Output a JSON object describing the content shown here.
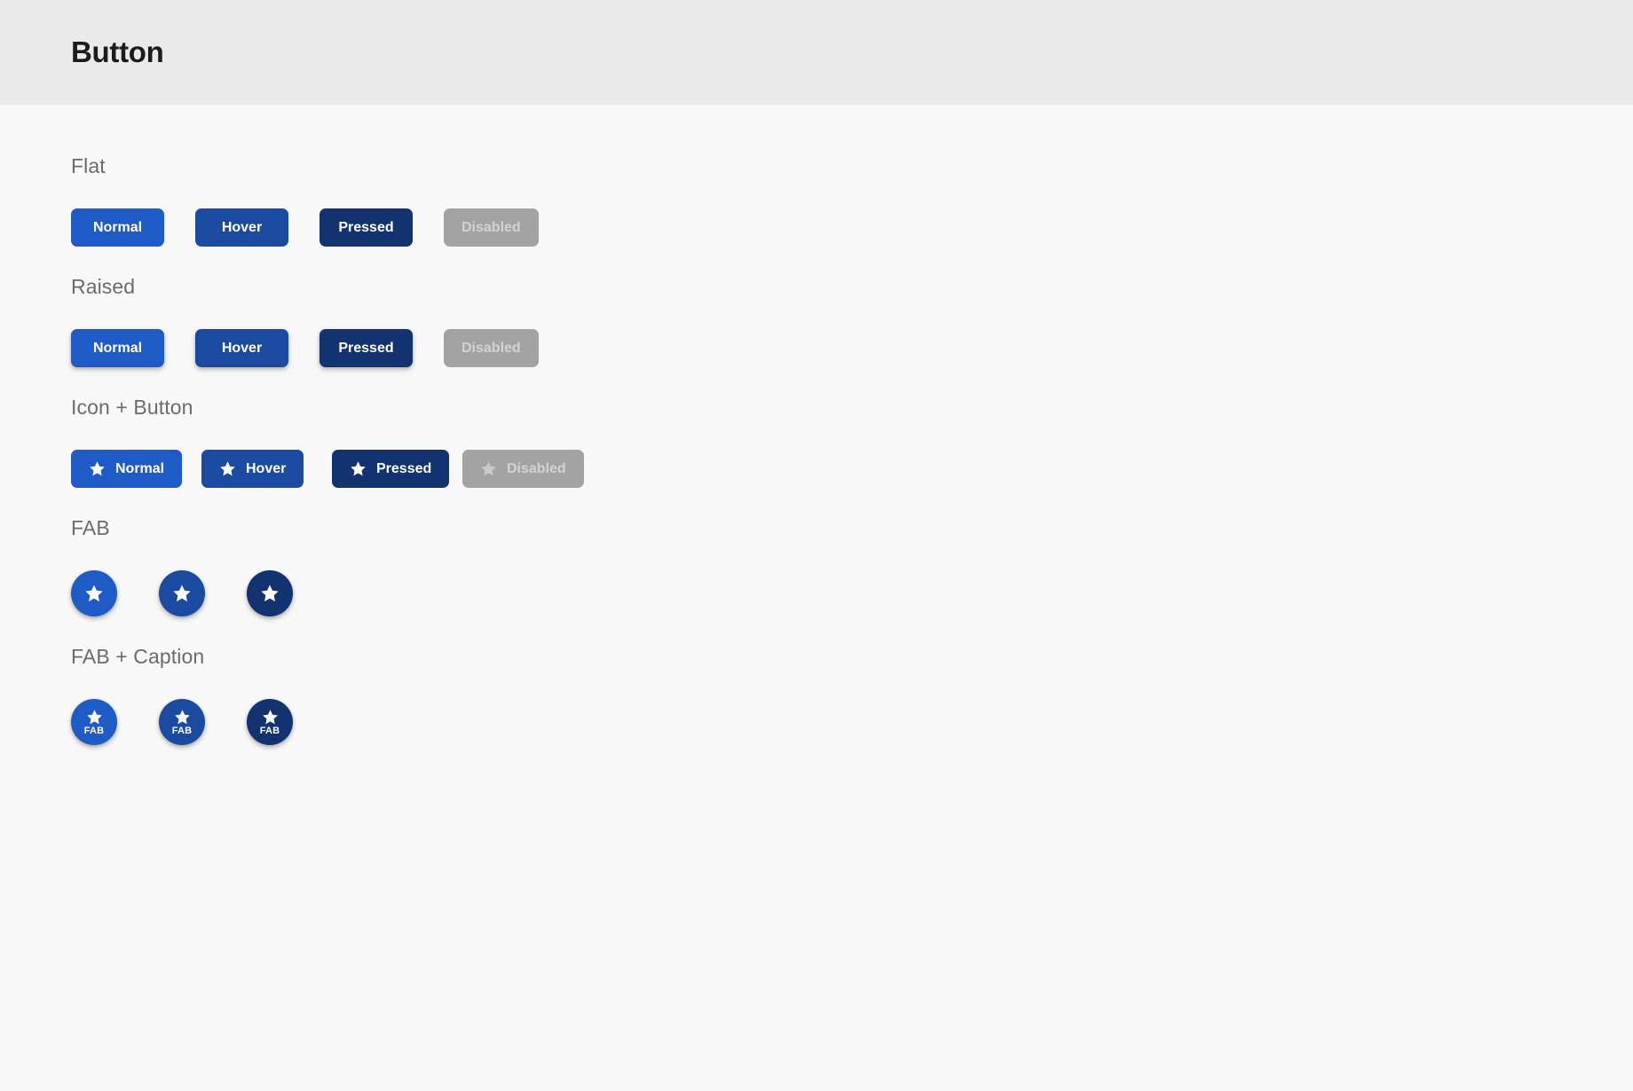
{
  "appbar": {
    "title": "Button"
  },
  "colors": {
    "normal": "#1e5bc6",
    "hover": "#1a4ba0",
    "pressed": "#123370",
    "disabled": "#a3a3a3",
    "disabled_text": "#d2d2d2",
    "header_bg": "#eaeaea",
    "page_bg": "#f8f8f8",
    "section_title": "#6b6b6b"
  },
  "sections": {
    "flat": {
      "title": "Flat",
      "buttons": [
        {
          "label": "Normal"
        },
        {
          "label": "Hover"
        },
        {
          "label": "Pressed"
        },
        {
          "label": "Disabled"
        }
      ]
    },
    "raised": {
      "title": "Raised",
      "buttons": [
        {
          "label": "Normal"
        },
        {
          "label": "Hover"
        },
        {
          "label": "Pressed"
        },
        {
          "label": "Disabled"
        }
      ]
    },
    "icon_button": {
      "title": "Icon + Button",
      "icon": "star-icon",
      "buttons": [
        {
          "label": "Normal"
        },
        {
          "label": "Hover"
        },
        {
          "label": "Pressed"
        },
        {
          "label": "Disabled"
        }
      ]
    },
    "fab": {
      "title": "FAB",
      "icon": "star-icon",
      "buttons": [
        {
          "state": "Normal"
        },
        {
          "state": "Hover"
        },
        {
          "state": "Pressed"
        }
      ]
    },
    "fab_caption": {
      "title": "FAB + Caption",
      "icon": "star-icon",
      "buttons": [
        {
          "state": "Normal",
          "caption": "FAB"
        },
        {
          "state": "Hover",
          "caption": "FAB"
        },
        {
          "state": "Pressed",
          "caption": "FAB"
        }
      ]
    }
  }
}
